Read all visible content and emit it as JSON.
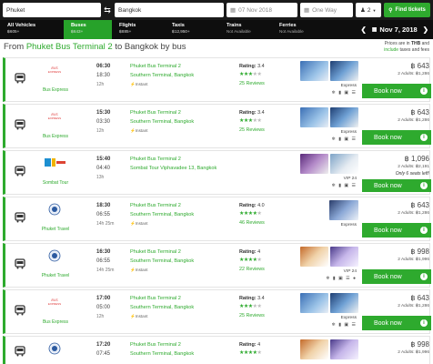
{
  "search": {
    "from_value": "Phuket",
    "to_value": "Bangkok",
    "date_value": "07 Nov 2018",
    "trip_type": "One Way",
    "passengers": "2",
    "find_label": "Find tickets"
  },
  "tabs": [
    {
      "label": "All Vehicles",
      "sub": "฿605+"
    },
    {
      "label": "Buses",
      "sub": "฿643+"
    },
    {
      "label": "Flights",
      "sub": "฿885+"
    },
    {
      "label": "Taxis",
      "sub": "฿12,950+"
    },
    {
      "label": "Trains",
      "sub": "Not Available"
    },
    {
      "label": "Ferries",
      "sub": "Not Available"
    }
  ],
  "date_nav": {
    "label": "Nov 7, 2018"
  },
  "route": {
    "prefix": "From ",
    "from": "Phuket Bus Terminal 2",
    "middle": " to Bangkok by bus"
  },
  "price_note": {
    "line1_pre": "Prices are in ",
    "currency": "THB",
    "line1_post": " and",
    "include": "include",
    "line2_post": " taxes and fees"
  },
  "book_label": "Book now",
  "instant_label": "Instant",
  "rating_label": "Rating:",
  "colors": {
    "accent": "#2eaa2e",
    "header": "#1a1a1a",
    "tabbar": "#0e0e0e"
  },
  "results": [
    {
      "operator": "Bus Express",
      "logo": "bus-express-logo",
      "dep": "06:30",
      "arr": "18:30",
      "dur": "12h",
      "from": "Phuket Bus Terminal 2",
      "to": "Southern Terminal, Bangkok",
      "rating": "3.4",
      "stars": 3,
      "reviews": "25 Reviews",
      "cls": "Express",
      "amenities": "❄ ▮ ▣ ☰",
      "price": "฿ 643",
      "adults": "2 Adults: ฿1,286",
      "seats": ""
    },
    {
      "operator": "Bus Express",
      "logo": "bus-express-logo",
      "dep": "15:30",
      "arr": "03:30",
      "dur": "12h",
      "from": "Phuket Bus Terminal 2",
      "to": "Southern Terminal, Bangkok",
      "rating": "3.4",
      "stars": 3,
      "reviews": "25 Reviews",
      "cls": "Express",
      "amenities": "❄ ▮ ▣ ☰",
      "price": "฿ 643",
      "adults": "2 Adults: ฿1,286",
      "seats": ""
    },
    {
      "operator": "Sombat Tour",
      "logo": "sombat-tour-logo",
      "dep": "15:40",
      "arr": "04:40",
      "dur": "13h",
      "from": "Phuket Bus Terminal 2",
      "to": "Sombat Tour Viphavadee 13, Bangkok",
      "rating": "",
      "stars": 0,
      "reviews": "",
      "cls": "VIP 24",
      "amenities": "❄ ▮ ▣ ☰",
      "price": "฿ 1,096",
      "adults": "2 Adults: ฿2,191",
      "seats": "Only 6 seats left!"
    },
    {
      "operator": "Phuket Travel",
      "logo": "phuket-travel-logo",
      "dep": "18:30",
      "arr": "06:55",
      "dur": "14h 25m",
      "from": "Phuket Bus Terminal 2",
      "to": "Southern Terminal, Bangkok",
      "rating": "4.0",
      "stars": 4,
      "reviews": "46 Reviews",
      "cls": "Express",
      "amenities": "",
      "price": "฿ 643",
      "adults": "2 Adults: ฿1,286",
      "seats": ""
    },
    {
      "operator": "Phuket Travel",
      "logo": "phuket-travel-logo",
      "dep": "16:30",
      "arr": "06:55",
      "dur": "14h 25m",
      "from": "Phuket Bus Terminal 2",
      "to": "Southern Terminal, Bangkok",
      "rating": "4",
      "stars": 4,
      "reviews": "22 Reviews",
      "cls": "VIP 24",
      "amenities": "❄ ▮ ▣ ☰ ●",
      "price": "฿ 998",
      "adults": "2 Adults: ฿1,996",
      "seats": ""
    },
    {
      "operator": "Bus Express",
      "logo": "bus-express-logo",
      "dep": "17:00",
      "arr": "05:00",
      "dur": "12h",
      "from": "Phuket Bus Terminal 2",
      "to": "Southern Terminal, Bangkok",
      "rating": "3.4",
      "stars": 3,
      "reviews": "25 Reviews",
      "cls": "Express",
      "amenities": "❄ ▮ ▣ ☰",
      "price": "฿ 643",
      "adults": "2 Adults: ฿1,286",
      "seats": ""
    },
    {
      "operator": "Phuket Travel",
      "logo": "phuket-travel-logo",
      "dep": "17:20",
      "arr": "07:45",
      "dur": "",
      "from": "Phuket Bus Terminal 2",
      "to": "Southern Terminal, Bangkok",
      "rating": "4",
      "stars": 4,
      "reviews": "",
      "cls": "",
      "amenities": "",
      "price": "฿ 998",
      "adults": "2 Adults: ฿1,996",
      "seats": ""
    }
  ]
}
